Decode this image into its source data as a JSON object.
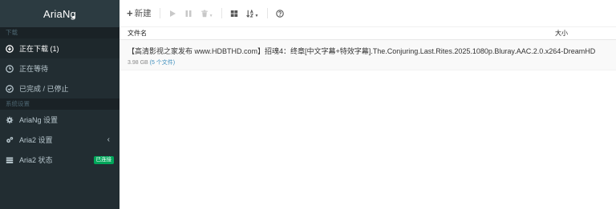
{
  "app": {
    "title": "AriaNg"
  },
  "sidebar": {
    "sections": [
      {
        "header": "下载"
      },
      {
        "header": "系统设置"
      }
    ],
    "downloads": [
      {
        "label": "正在下载 (1)",
        "icon": "download-circle-icon",
        "active": true
      },
      {
        "label": "正在等待",
        "icon": "clock-icon",
        "active": false
      },
      {
        "label": "已完成 / 已停止",
        "icon": "check-circle-icon",
        "active": false
      }
    ],
    "settings": [
      {
        "label": "AriaNg 设置",
        "icon": "gear-icon"
      },
      {
        "label": "Aria2 设置",
        "icon": "gears-icon",
        "chevron": "‹"
      },
      {
        "label": "Aria2 状态",
        "icon": "server-icon",
        "badge": "已连接"
      }
    ]
  },
  "toolbar": {
    "new_label": "新建"
  },
  "table": {
    "col_name": "文件名",
    "col_size": "大小",
    "rows": [
      {
        "name": "【高清影视之家发布 www.HDBTHD.com】招魂4：终章[中文字幕+特效字幕].The.Conjuring.Last.Rites.2025.1080p.Bluray.AAC.2.0.x264-DreamHD",
        "size": "3.98 GB",
        "files": "(5 个文件)"
      }
    ]
  },
  "colors": {
    "sidebar_bg": "#222d32",
    "sidebar_header_bg": "#1a2226",
    "badge_green": "#00a65a",
    "link_blue": "#3c8dbc"
  }
}
